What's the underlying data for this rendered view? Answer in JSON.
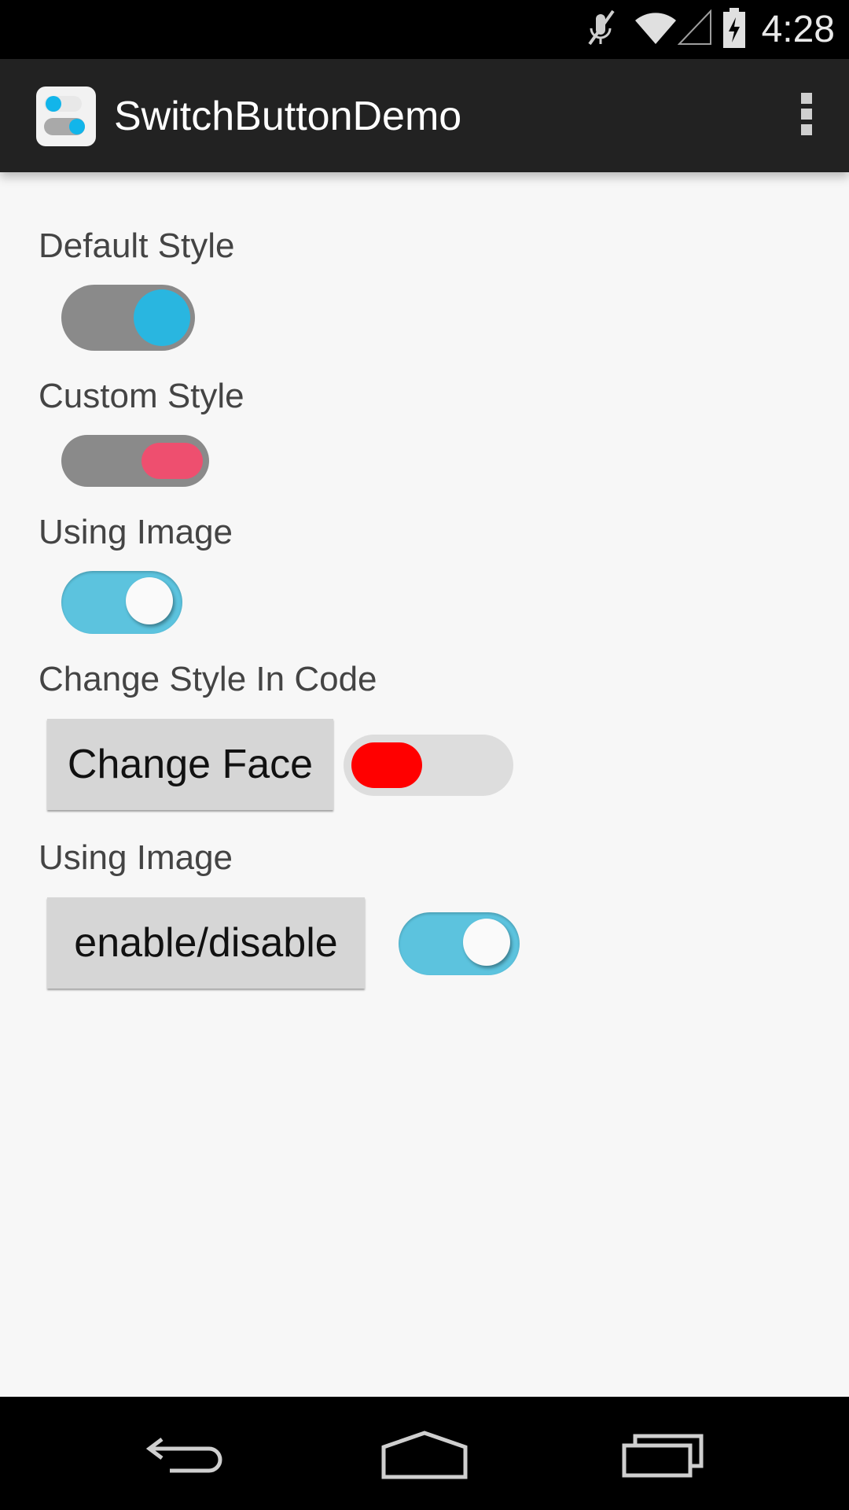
{
  "status_bar": {
    "time": "4:28",
    "icons": [
      "mute-icon",
      "wifi-icon",
      "signal-icon",
      "battery-charging-icon"
    ]
  },
  "action_bar": {
    "title": "SwitchButtonDemo",
    "app_icon": "switch-app-icon",
    "menu_icon": "overflow-menu-icon"
  },
  "sections": {
    "default_style": {
      "label": "Default Style",
      "checked": true,
      "track_color": "#8a8a8a",
      "thumb_color": "#29b6e0"
    },
    "custom_style": {
      "label": "Custom Style",
      "checked": true,
      "track_color": "#8a8a8a",
      "thumb_color": "#ee4f6f"
    },
    "using_image_1": {
      "label": "Using Image",
      "checked": true,
      "track_color": "#5cc3de",
      "thumb_color": "#fafafa"
    },
    "change_style": {
      "label": "Change Style In Code",
      "button_label": "Change Face",
      "checked": false,
      "track_color": "#dddddd",
      "thumb_color": "#ff0000"
    },
    "using_image_2": {
      "label": "Using Image",
      "button_label": "enable/disable",
      "checked": true,
      "track_color": "#5cc3de",
      "thumb_color": "#fafafa"
    }
  },
  "nav_bar": {
    "icons": [
      "back-icon",
      "home-icon",
      "recent-apps-icon"
    ]
  }
}
